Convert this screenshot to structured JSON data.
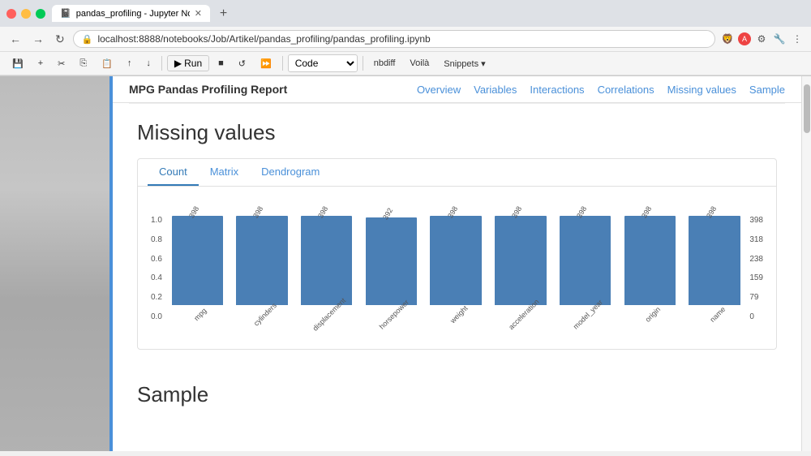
{
  "browser": {
    "tab_title": "pandas_profiling - Jupyter Noteb...",
    "url": "localhost:8888/notebooks/Job/Artikel/pandas_profiling/pandas_profiling.ipynb",
    "win_buttons": [
      "close",
      "min",
      "max"
    ]
  },
  "toolbar": {
    "run_label": "Run",
    "cell_type": "Code",
    "nbdiff_label": "nbdiff",
    "voila_label": "Voilà",
    "snippets_label": "Snippets ▾"
  },
  "report": {
    "title": "MPG Pandas Profiling Report",
    "nav_links": [
      "Overview",
      "Variables",
      "Interactions",
      "Correlations",
      "Missing values",
      "Sample"
    ]
  },
  "missing_values": {
    "heading": "Missing values",
    "tabs": [
      "Count",
      "Matrix",
      "Dendrogram"
    ],
    "active_tab": "Count",
    "y_axis_labels": [
      "1.0",
      "0.8",
      "0.6",
      "0.4",
      "0.2",
      "0.0"
    ],
    "right_y_axis_labels": [
      "398",
      "318",
      "238",
      "159",
      "79",
      "0"
    ],
    "bars": [
      {
        "label": "mpg",
        "count": "398",
        "height_pct": 100
      },
      {
        "label": "cylinders",
        "count": "398",
        "height_pct": 100
      },
      {
        "label": "displacement",
        "count": "398",
        "height_pct": 100
      },
      {
        "label": "horsepower",
        "count": "392",
        "height_pct": 98.5
      },
      {
        "label": "weight",
        "count": "398",
        "height_pct": 100
      },
      {
        "label": "acceleration",
        "count": "398",
        "height_pct": 100
      },
      {
        "label": "model_year",
        "count": "398",
        "height_pct": 100
      },
      {
        "label": "origin",
        "count": "398",
        "height_pct": 100
      },
      {
        "label": "name",
        "count": "398",
        "height_pct": 100
      }
    ]
  },
  "sample": {
    "heading": "Sample"
  },
  "colors": {
    "bar_color": "#4a7fb5",
    "active_tab_color": "#337ab7",
    "link_color": "#4a90d9"
  }
}
